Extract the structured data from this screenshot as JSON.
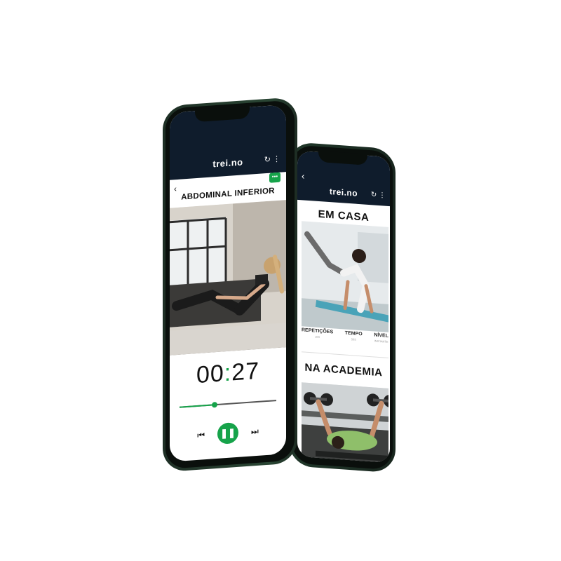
{
  "brand": "trei.no",
  "front": {
    "title": "ABDOMINAL INFERIOR",
    "timer": {
      "minutes": "00",
      "separator": ":",
      "seconds": "27"
    },
    "progress": 0.36,
    "icons": {
      "back": "chevron-left-icon",
      "refresh": "refresh-icon",
      "menu": "more-vertical-icon",
      "chat": "chat-icon",
      "previous": "skip-previous-icon",
      "pause": "pause-icon",
      "next": "skip-next-icon"
    }
  },
  "back": {
    "sections": [
      {
        "title": "EM CASA"
      },
      {
        "title": "NA ACADEMIA"
      }
    ],
    "stats": [
      {
        "label": "REPETIÇÕES",
        "value": "10X"
      },
      {
        "label": "TEMPO",
        "value": "30S"
      },
      {
        "label": "NÍVEL",
        "value": "INICIANTE"
      }
    ]
  },
  "colors": {
    "accent": "#16a34a",
    "header": "#0f1c2c",
    "frame": "#1e2f25"
  }
}
